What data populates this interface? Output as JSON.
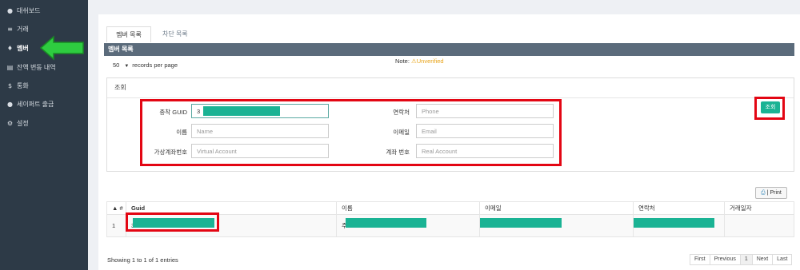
{
  "sidebar": {
    "items": [
      {
        "label": "대쉬보드",
        "icon": "●"
      },
      {
        "label": "거래",
        "icon": "≡"
      },
      {
        "label": "멤버",
        "icon": "♦"
      },
      {
        "label": "잔액 변동 내역",
        "icon": "▤"
      },
      {
        "label": "통화",
        "icon": "$"
      },
      {
        "label": "세이퍼트 출금",
        "icon": "●"
      },
      {
        "label": "설정",
        "icon": "⚙"
      }
    ],
    "accent_arrow_color": "#2ecc40"
  },
  "tabs": [
    {
      "label": "멤버 목록"
    },
    {
      "label": "차단 목록"
    }
  ],
  "box_header": "멤버 목록",
  "records": {
    "value": "50",
    "label": "records per page"
  },
  "note": {
    "label": "Note:",
    "warn_icon": "⚠",
    "status": "Unverified",
    "status_color": "#e8a317"
  },
  "search": {
    "title": "조회",
    "fields": {
      "guid": {
        "label": "종착 GUID",
        "value": "3"
      },
      "name": {
        "label": "이름",
        "placeholder": "Name"
      },
      "vaccount": {
        "label": "가상계좌번호",
        "placeholder": "Virtual Account"
      },
      "phone": {
        "label": "연락처",
        "placeholder": "Phone"
      },
      "email": {
        "label": "이메일",
        "placeholder": "Email"
      },
      "raccount": {
        "label": "계좌 번호",
        "placeholder": "Real Account"
      }
    },
    "button": "조회"
  },
  "print_button": {
    "icon": "⎙",
    "label": "| Print"
  },
  "table": {
    "headers": [
      "▲ #",
      "Guid",
      "이름",
      "이메일",
      "연락처",
      "거래일자"
    ],
    "rows": [
      {
        "num": "1",
        "guid_prefix": "3",
        "name_prefix": "주",
        "email": "",
        "phone": "",
        "date": ""
      }
    ]
  },
  "footer": {
    "info": "Showing 1 to 1 of 1 entries"
  },
  "pager": [
    "First",
    "Previous",
    "1",
    "Next",
    "Last"
  ],
  "colors": {
    "sidebar_bg": "#2d3a47",
    "header_bg": "#5b6b7b",
    "accent": "#1ab394",
    "highlight": "#e30613"
  }
}
